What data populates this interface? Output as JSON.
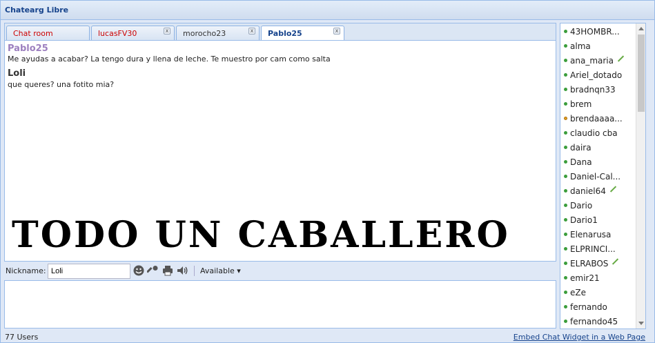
{
  "window": {
    "title": "Chatearg Libre"
  },
  "tabs": [
    {
      "label": "Chat room",
      "color": "#cc0000"
    },
    {
      "label": "lucasFV30",
      "color": "#cc0000",
      "close": "x"
    },
    {
      "label": "morocho23",
      "color": "#333333",
      "close": "x"
    },
    {
      "label": "Pablo25",
      "color": "#15428b",
      "close": "x"
    }
  ],
  "messages": [
    {
      "sender": "Pablo25",
      "sender_color": "#9c7fbf",
      "text": "Me ayudas a acabar? La tengo dura y llena de leche. Te muestro por cam como salta"
    },
    {
      "sender": "Loli",
      "sender_color": "#333333",
      "text": "que queres? una fotito mia?"
    }
  ],
  "banner": "TODO UN CABALLERO",
  "toolbar": {
    "nickname_label": "Nickname:",
    "nickname_value": "Loli",
    "icons": [
      "smiley-icon",
      "key-icon",
      "printer-icon",
      "speaker-icon"
    ],
    "status_label": "Available ▾"
  },
  "footer": {
    "user_count": "77 Users",
    "embed_link": "Embed Chat Widget in a Web Page"
  },
  "users": [
    {
      "name": "43HOMBR...",
      "status": "online",
      "cam": false
    },
    {
      "name": "alma",
      "status": "online",
      "cam": false
    },
    {
      "name": "ana_maria",
      "status": "online",
      "cam": true
    },
    {
      "name": "Ariel_dotado",
      "status": "online",
      "cam": false
    },
    {
      "name": "bradnqn33",
      "status": "online",
      "cam": false
    },
    {
      "name": "brem",
      "status": "online",
      "cam": false
    },
    {
      "name": "brendaaaa...",
      "status": "away",
      "cam": false
    },
    {
      "name": "claudio cba",
      "status": "online",
      "cam": false
    },
    {
      "name": "daira",
      "status": "online",
      "cam": false
    },
    {
      "name": "Dana",
      "status": "online",
      "cam": false
    },
    {
      "name": "Daniel-Cal...",
      "status": "online",
      "cam": false
    },
    {
      "name": "daniel64",
      "status": "online",
      "cam": true
    },
    {
      "name": "Dario",
      "status": "online",
      "cam": false
    },
    {
      "name": "Dario1",
      "status": "online",
      "cam": false
    },
    {
      "name": "Elenarusa",
      "status": "online",
      "cam": false
    },
    {
      "name": "ELPRINCI...",
      "status": "online",
      "cam": false
    },
    {
      "name": "ELRABOS",
      "status": "online",
      "cam": true
    },
    {
      "name": "emir21",
      "status": "online",
      "cam": false
    },
    {
      "name": "eZe",
      "status": "online",
      "cam": false
    },
    {
      "name": "fernando",
      "status": "online",
      "cam": false
    },
    {
      "name": "fernando45",
      "status": "online",
      "cam": false
    }
  ]
}
